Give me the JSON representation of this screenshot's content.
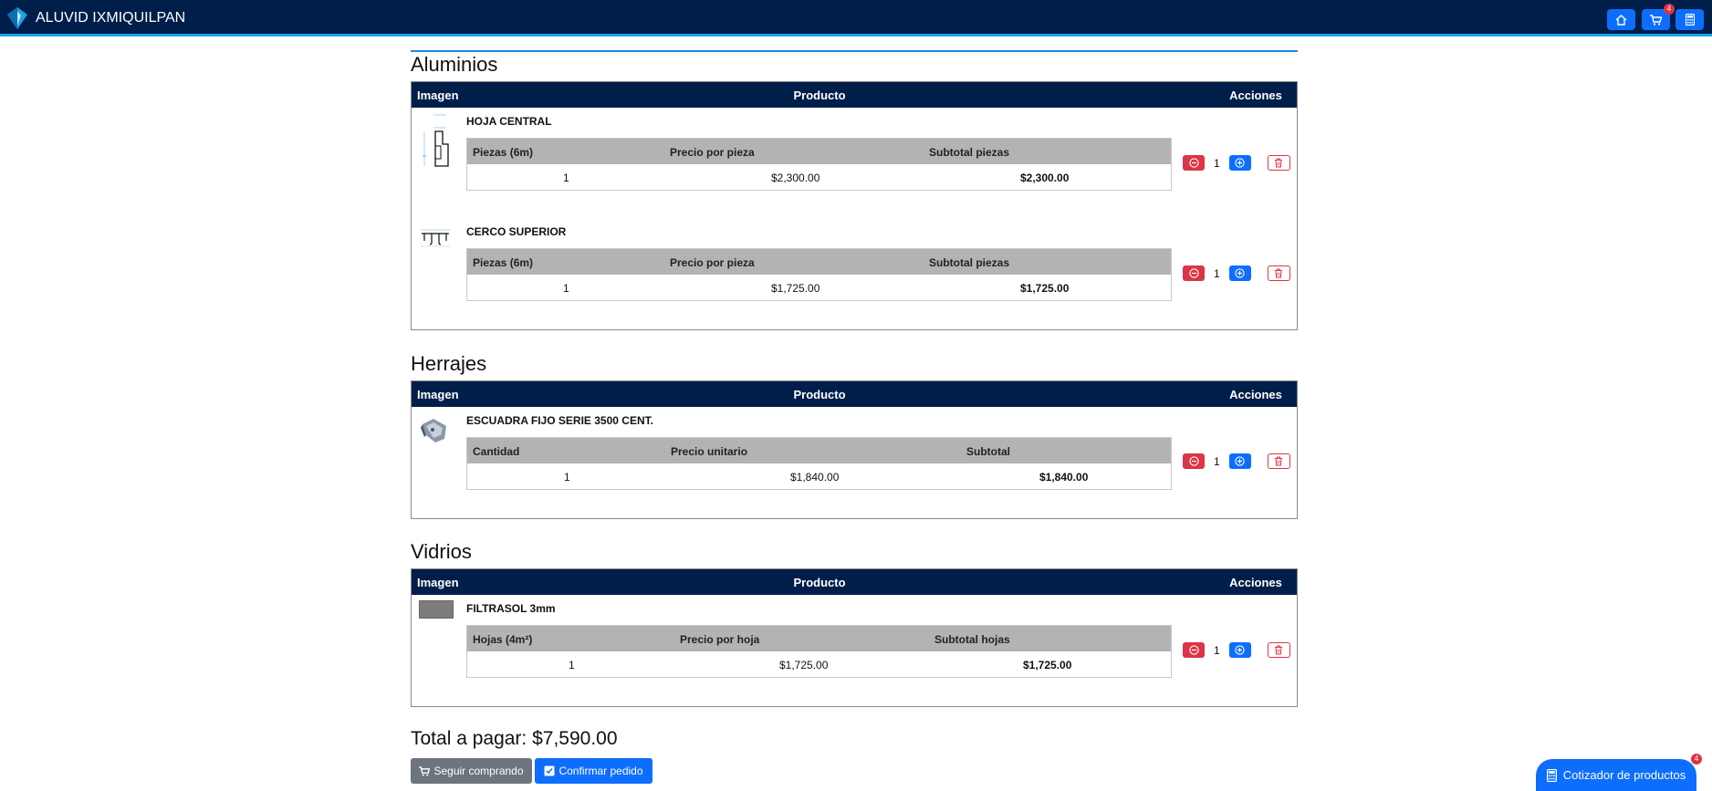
{
  "app": {
    "brand_name": "ALUVID IXMIQUILPAN",
    "cart_badge": "4"
  },
  "table_headers": {
    "image": "Imagen",
    "product": "Producto",
    "actions": "Acciones"
  },
  "sections": {
    "aluminios": {
      "title": "Aluminios",
      "items": [
        {
          "name": "HOJA CENTRAL",
          "col1": "Piezas (6m)",
          "col2": "Precio por pieza",
          "col3": "Subtotal piezas",
          "v1": "1",
          "v2": "$2,300.00",
          "v3": "$2,300.00",
          "qty": "1"
        },
        {
          "name": "CERCO SUPERIOR",
          "col1": "Piezas (6m)",
          "col2": "Precio por pieza",
          "col3": "Subtotal piezas",
          "v1": "1",
          "v2": "$1,725.00",
          "v3": "$1,725.00",
          "qty": "1"
        }
      ]
    },
    "herrajes": {
      "title": "Herrajes",
      "items": [
        {
          "name": "ESCUADRA FIJO SERIE 3500 CENT.",
          "col1": "Cantidad",
          "col2": "Precio unitario",
          "col3": "Subtotal",
          "v1": "1",
          "v2": "$1,840.00",
          "v3": "$1,840.00",
          "qty": "1"
        }
      ]
    },
    "vidrios": {
      "title": "Vidrios",
      "items": [
        {
          "name": "FILTRASOL 3mm",
          "col1": "Hojas (4m²)",
          "col2": "Precio por hoja",
          "col3": "Subtotal hojas",
          "v1": "1",
          "v2": "$1,725.00",
          "v3": "$1,725.00",
          "qty": "1"
        }
      ]
    }
  },
  "footer": {
    "total_label": "Total a pagar: $7,590.00",
    "continue_label": "Seguir comprando",
    "confirm_label": "Confirmar pedido",
    "quote_label": "Cotizador de productos",
    "quote_badge": "4"
  },
  "colors": {
    "navbar": "#001e4a",
    "primary": "#0d6efd",
    "danger": "#dc3545",
    "secondary": "#6c757d"
  }
}
